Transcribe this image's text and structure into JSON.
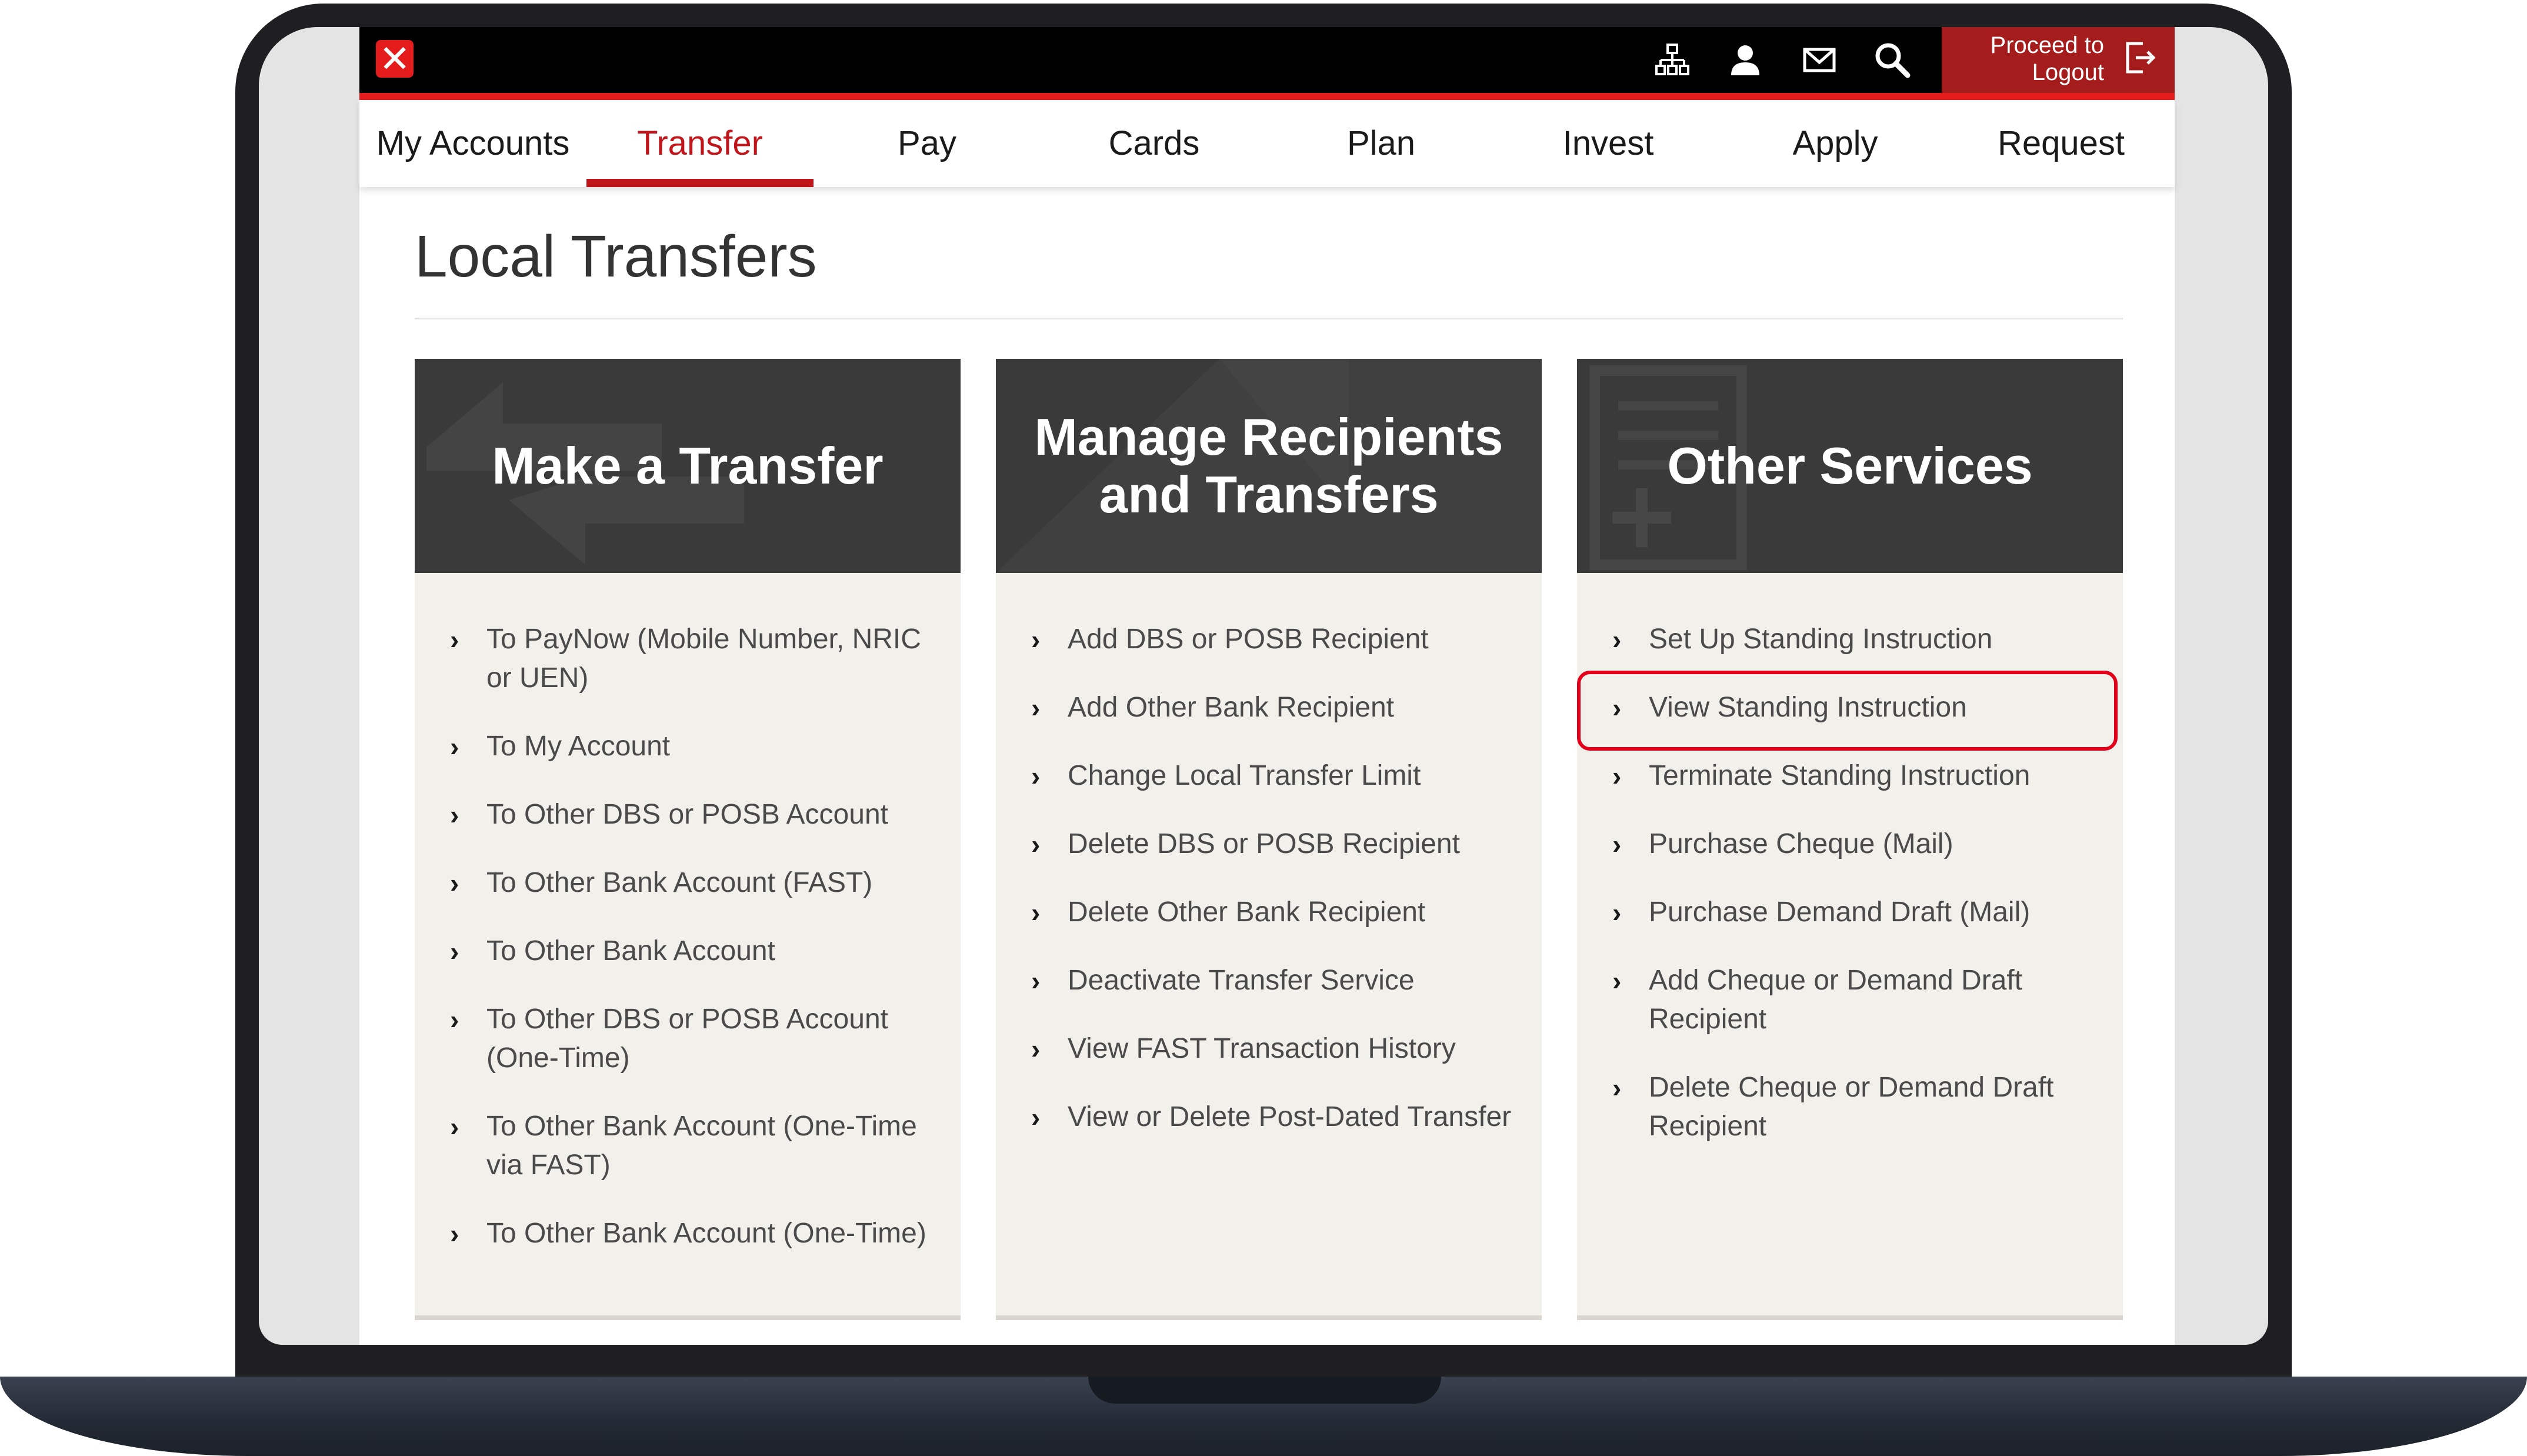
{
  "header": {
    "logout": {
      "line1": "Proceed to",
      "line2": "Logout"
    },
    "icons": [
      "sitemap-icon",
      "user-icon",
      "mail-icon",
      "search-icon",
      "logout-icon"
    ]
  },
  "nav": {
    "tabs": [
      {
        "label": "My Accounts"
      },
      {
        "label": "Transfer"
      },
      {
        "label": "Pay"
      },
      {
        "label": "Cards"
      },
      {
        "label": "Plan"
      },
      {
        "label": "Invest"
      },
      {
        "label": "Apply"
      },
      {
        "label": "Request"
      }
    ],
    "active": "Transfer"
  },
  "page": {
    "title": "Local Transfers"
  },
  "panels": [
    {
      "title": "Make a Transfer",
      "items": [
        "To PayNow (Mobile Number, NRIC or UEN)",
        "To My Account",
        "To Other DBS or POSB Account",
        "To Other Bank Account (FAST)",
        "To Other Bank Account",
        "To Other DBS or POSB Account (One-Time)",
        "To Other Bank Account (One-Time via FAST)",
        "To Other Bank Account (One-Time)"
      ]
    },
    {
      "title": "Manage Recipients and Transfers",
      "items": [
        "Add DBS or POSB Recipient",
        "Add Other Bank Recipient",
        "Change Local Transfer Limit",
        "Delete DBS or POSB Recipient",
        "Delete Other Bank Recipient",
        "Deactivate Transfer Service",
        "View FAST Transaction History",
        "View or Delete Post-Dated Transfer"
      ]
    },
    {
      "title": "Other Services",
      "items": [
        "Set Up Standing Instruction",
        "View Standing Instruction",
        "Terminate Standing Instruction",
        "Purchase Cheque (Mail)",
        "Purchase Demand Draft (Mail)",
        "Add Cheque or Demand Draft Recipient",
        "Delete Cheque or Demand Draft Recipient"
      ],
      "highlighted": "View Standing Instruction"
    }
  ],
  "colors": {
    "brand_red": "#e41c1c",
    "highlight_red": "#e3001b",
    "panel_header": "#3a3a3a",
    "panel_body": "#f2f0eb"
  }
}
